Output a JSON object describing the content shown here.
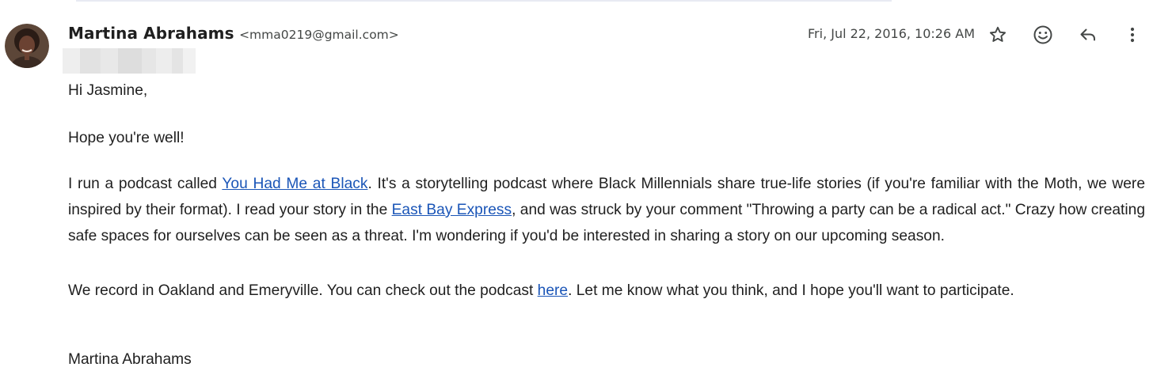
{
  "message": {
    "sender_name": "Martina Abrahams",
    "sender_email": "<mma0219@gmail.com>",
    "date": "Fri, Jul 22, 2016, 10:26 AM"
  },
  "actions": [
    {
      "name": "star-icon"
    },
    {
      "name": "emoji-icon"
    },
    {
      "name": "reply-icon"
    },
    {
      "name": "more-icon"
    }
  ],
  "body": {
    "greeting": "Hi Jasmine,",
    "p1": "Hope you're well!",
    "p2": {
      "t1": "I run a podcast called ",
      "link1": "You Had Me at Black",
      "t2": ". It's a storytelling podcast where Black Millennials share true-life stories (if you're familiar with the Moth, we were inspired by their format). I read your story in the ",
      "link2": "East Bay Express",
      "t3": ", and was struck by your comment \"Throwing a party can be a radical act.\" Crazy how creating safe spaces for ourselves can be seen as a threat. I'm wondering if you'd be interested in sharing a story on our upcoming season."
    },
    "p3": {
      "t1": "We record in Oakland and Emeryville. You can check out the podcast ",
      "link": "here",
      "t2": ". Let me know what you think, and I hope you'll want to participate."
    },
    "signature": "Martina Abrahams"
  },
  "colors": {
    "link": "#1a55b7",
    "text": "#1f1f1f",
    "secondary": "#444746"
  }
}
